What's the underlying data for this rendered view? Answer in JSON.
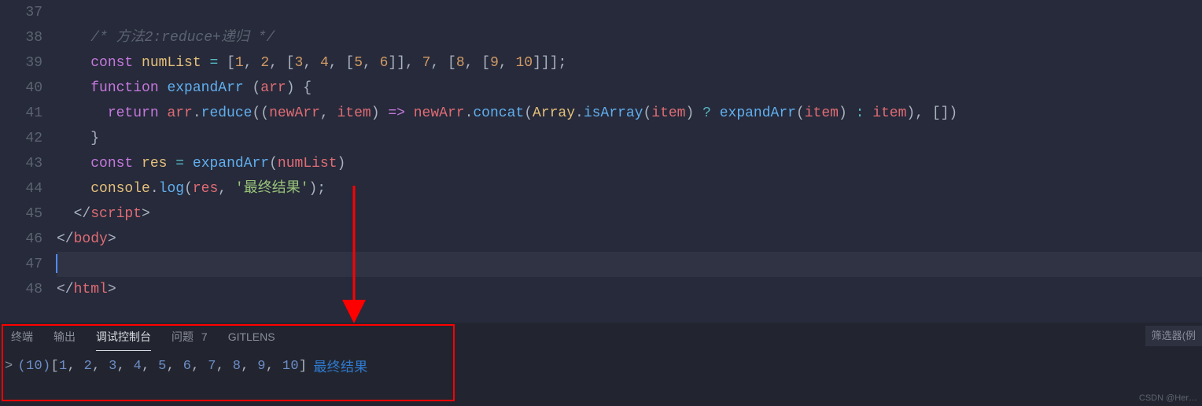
{
  "editor": {
    "lines": [
      {
        "num": "37",
        "tokens": []
      },
      {
        "num": "38",
        "tokens": [
          {
            "t": "    ",
            "c": "punc"
          },
          {
            "t": "/* 方法2:reduce+递归 */",
            "c": "cm"
          }
        ]
      },
      {
        "num": "39",
        "tokens": [
          {
            "t": "    ",
            "c": "punc"
          },
          {
            "t": "const",
            "c": "kw"
          },
          {
            "t": " ",
            "c": "punc"
          },
          {
            "t": "numList",
            "c": "var"
          },
          {
            "t": " ",
            "c": "punc"
          },
          {
            "t": "=",
            "c": "op"
          },
          {
            "t": " [",
            "c": "punc"
          },
          {
            "t": "1",
            "c": "num"
          },
          {
            "t": ", ",
            "c": "punc"
          },
          {
            "t": "2",
            "c": "num"
          },
          {
            "t": ", [",
            "c": "punc"
          },
          {
            "t": "3",
            "c": "num"
          },
          {
            "t": ", ",
            "c": "punc"
          },
          {
            "t": "4",
            "c": "num"
          },
          {
            "t": ", [",
            "c": "punc"
          },
          {
            "t": "5",
            "c": "num"
          },
          {
            "t": ", ",
            "c": "punc"
          },
          {
            "t": "6",
            "c": "num"
          },
          {
            "t": "]], ",
            "c": "punc"
          },
          {
            "t": "7",
            "c": "num"
          },
          {
            "t": ", [",
            "c": "punc"
          },
          {
            "t": "8",
            "c": "num"
          },
          {
            "t": ", [",
            "c": "punc"
          },
          {
            "t": "9",
            "c": "num"
          },
          {
            "t": ", ",
            "c": "punc"
          },
          {
            "t": "10",
            "c": "num"
          },
          {
            "t": "]]];",
            "c": "punc"
          }
        ]
      },
      {
        "num": "40",
        "tokens": [
          {
            "t": "    ",
            "c": "punc"
          },
          {
            "t": "function",
            "c": "kw"
          },
          {
            "t": " ",
            "c": "punc"
          },
          {
            "t": "expandArr",
            "c": "fn"
          },
          {
            "t": " (",
            "c": "punc"
          },
          {
            "t": "arr",
            "c": "param"
          },
          {
            "t": ") {",
            "c": "punc"
          }
        ]
      },
      {
        "num": "41",
        "tokens": [
          {
            "t": "      ",
            "c": "punc"
          },
          {
            "t": "return",
            "c": "kw"
          },
          {
            "t": " ",
            "c": "punc"
          },
          {
            "t": "arr",
            "c": "param"
          },
          {
            "t": ".",
            "c": "punc"
          },
          {
            "t": "reduce",
            "c": "fn"
          },
          {
            "t": "((",
            "c": "punc"
          },
          {
            "t": "newArr",
            "c": "param"
          },
          {
            "t": ", ",
            "c": "punc"
          },
          {
            "t": "item",
            "c": "param"
          },
          {
            "t": ") ",
            "c": "punc"
          },
          {
            "t": "=>",
            "c": "kw"
          },
          {
            "t": " ",
            "c": "punc"
          },
          {
            "t": "newArr",
            "c": "param"
          },
          {
            "t": ".",
            "c": "punc"
          },
          {
            "t": "concat",
            "c": "fn"
          },
          {
            "t": "(",
            "c": "punc"
          },
          {
            "t": "Array",
            "c": "var"
          },
          {
            "t": ".",
            "c": "punc"
          },
          {
            "t": "isArray",
            "c": "fn"
          },
          {
            "t": "(",
            "c": "punc"
          },
          {
            "t": "item",
            "c": "param"
          },
          {
            "t": ") ",
            "c": "punc"
          },
          {
            "t": "?",
            "c": "op"
          },
          {
            "t": " ",
            "c": "punc"
          },
          {
            "t": "expandArr",
            "c": "fn"
          },
          {
            "t": "(",
            "c": "punc"
          },
          {
            "t": "item",
            "c": "param"
          },
          {
            "t": ") ",
            "c": "punc"
          },
          {
            "t": ":",
            "c": "op"
          },
          {
            "t": " ",
            "c": "punc"
          },
          {
            "t": "item",
            "c": "param"
          },
          {
            "t": "), [])",
            "c": "punc"
          }
        ]
      },
      {
        "num": "42",
        "tokens": [
          {
            "t": "    }",
            "c": "punc"
          }
        ]
      },
      {
        "num": "43",
        "tokens": [
          {
            "t": "    ",
            "c": "punc"
          },
          {
            "t": "const",
            "c": "kw"
          },
          {
            "t": " ",
            "c": "punc"
          },
          {
            "t": "res",
            "c": "var"
          },
          {
            "t": " ",
            "c": "punc"
          },
          {
            "t": "=",
            "c": "op"
          },
          {
            "t": " ",
            "c": "punc"
          },
          {
            "t": "expandArr",
            "c": "fn"
          },
          {
            "t": "(",
            "c": "punc"
          },
          {
            "t": "numList",
            "c": "param"
          },
          {
            "t": ")",
            "c": "punc"
          }
        ]
      },
      {
        "num": "44",
        "tokens": [
          {
            "t": "    ",
            "c": "punc"
          },
          {
            "t": "console",
            "c": "var"
          },
          {
            "t": ".",
            "c": "punc"
          },
          {
            "t": "log",
            "c": "fn"
          },
          {
            "t": "(",
            "c": "punc"
          },
          {
            "t": "res",
            "c": "param"
          },
          {
            "t": ", ",
            "c": "punc"
          },
          {
            "t": "'最终结果'",
            "c": "str"
          },
          {
            "t": ");",
            "c": "punc"
          }
        ]
      },
      {
        "num": "45",
        "tokens": [
          {
            "t": "  ",
            "c": "punc"
          },
          {
            "t": "</",
            "c": "tagb"
          },
          {
            "t": "script",
            "c": "tag"
          },
          {
            "t": ">",
            "c": "tagb"
          }
        ]
      },
      {
        "num": "46",
        "tokens": [
          {
            "t": "",
            "c": "punc"
          },
          {
            "t": "</",
            "c": "tagb"
          },
          {
            "t": "body",
            "c": "tag"
          },
          {
            "t": ">",
            "c": "tagb"
          }
        ]
      },
      {
        "num": "47",
        "tokens": [],
        "active": true
      },
      {
        "num": "48",
        "tokens": [
          {
            "t": "",
            "c": "punc"
          },
          {
            "t": "</",
            "c": "tagb"
          },
          {
            "t": "html",
            "c": "tag"
          },
          {
            "t": ">",
            "c": "tagb"
          }
        ]
      }
    ]
  },
  "panel": {
    "tabs": {
      "terminal": "终端",
      "output": "输出",
      "debug": "调试控制台",
      "problems": "问题",
      "problems_count": "7",
      "gitlens": "GITLENS"
    },
    "filter_placeholder": "筛选器(例",
    "console": {
      "chevron": ">",
      "count": "(10)",
      "open": " [",
      "values": [
        "1",
        "2",
        "3",
        "4",
        "5",
        "6",
        "7",
        "8",
        "9",
        "10"
      ],
      "close": "]",
      "label": "最终结果"
    }
  },
  "watermark": "CSDN @Her…"
}
